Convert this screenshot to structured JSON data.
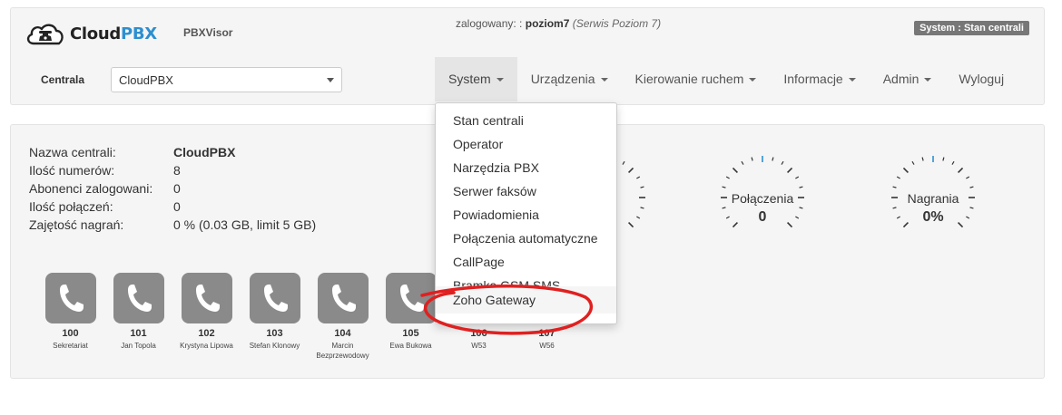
{
  "header": {
    "logo_text_a": "Cloud",
    "logo_text_b": "PBX",
    "app_name": "PBXVisor",
    "logged_prefix": "zalogowany: :",
    "logged_user": "poziom7",
    "logged_role": "(Serwis Poziom 7)",
    "system_badge": "System : Stan centrali",
    "centrala_label": "Centrala",
    "centrala_value": "CloudPBX"
  },
  "nav": {
    "items": [
      {
        "label": "System",
        "caret": true
      },
      {
        "label": "Urządzenia",
        "caret": true
      },
      {
        "label": "Kierowanie ruchem",
        "caret": true
      },
      {
        "label": "Informacje",
        "caret": true
      },
      {
        "label": "Admin",
        "caret": true
      },
      {
        "label": "Wyloguj",
        "caret": false
      }
    ]
  },
  "dropdown": {
    "items": [
      "Stan centrali",
      "Operator",
      "Narzędzia PBX",
      "Serwer faksów",
      "Powiadomienia",
      "Połączenia automatyczne",
      "CallPage",
      "Bramka GSM SMS",
      "Zoho Gateway"
    ]
  },
  "info": {
    "rows": [
      {
        "k": "Nazwa centrali:",
        "v": "CloudPBX"
      },
      {
        "k": "Ilość numerów:",
        "v": "8"
      },
      {
        "k": "Abonenci zalogowani:",
        "v": "0"
      },
      {
        "k": "Ilość połączeń:",
        "v": "0"
      },
      {
        "k": "Zajętość nagrań:",
        "v": "0 % (0.03 GB, limit 5 GB)"
      }
    ]
  },
  "gauges": [
    {
      "label": "Połączenia",
      "value": "0"
    },
    {
      "label": "Nagrania",
      "value": "0%"
    }
  ],
  "phones": [
    {
      "num": "100",
      "name": "Sekretariat"
    },
    {
      "num": "101",
      "name": "Jan Topola"
    },
    {
      "num": "102",
      "name": "Krystyna Lipowa"
    },
    {
      "num": "103",
      "name": "Stefan Klonowy"
    },
    {
      "num": "104",
      "name": "Marcin Bezprzewodowy"
    },
    {
      "num": "105",
      "name": "Ewa Bukowa"
    },
    {
      "num": "106",
      "name": "W53"
    },
    {
      "num": "107",
      "name": "W56"
    }
  ],
  "colors": {
    "accent": "#2d8fd0",
    "annotation": "#e02020",
    "phone_tile": "#8a8a8a"
  },
  "icons": [
    "cloud-phone-logo-icon",
    "phone-handset-icon",
    "chevron-down-icon"
  ]
}
